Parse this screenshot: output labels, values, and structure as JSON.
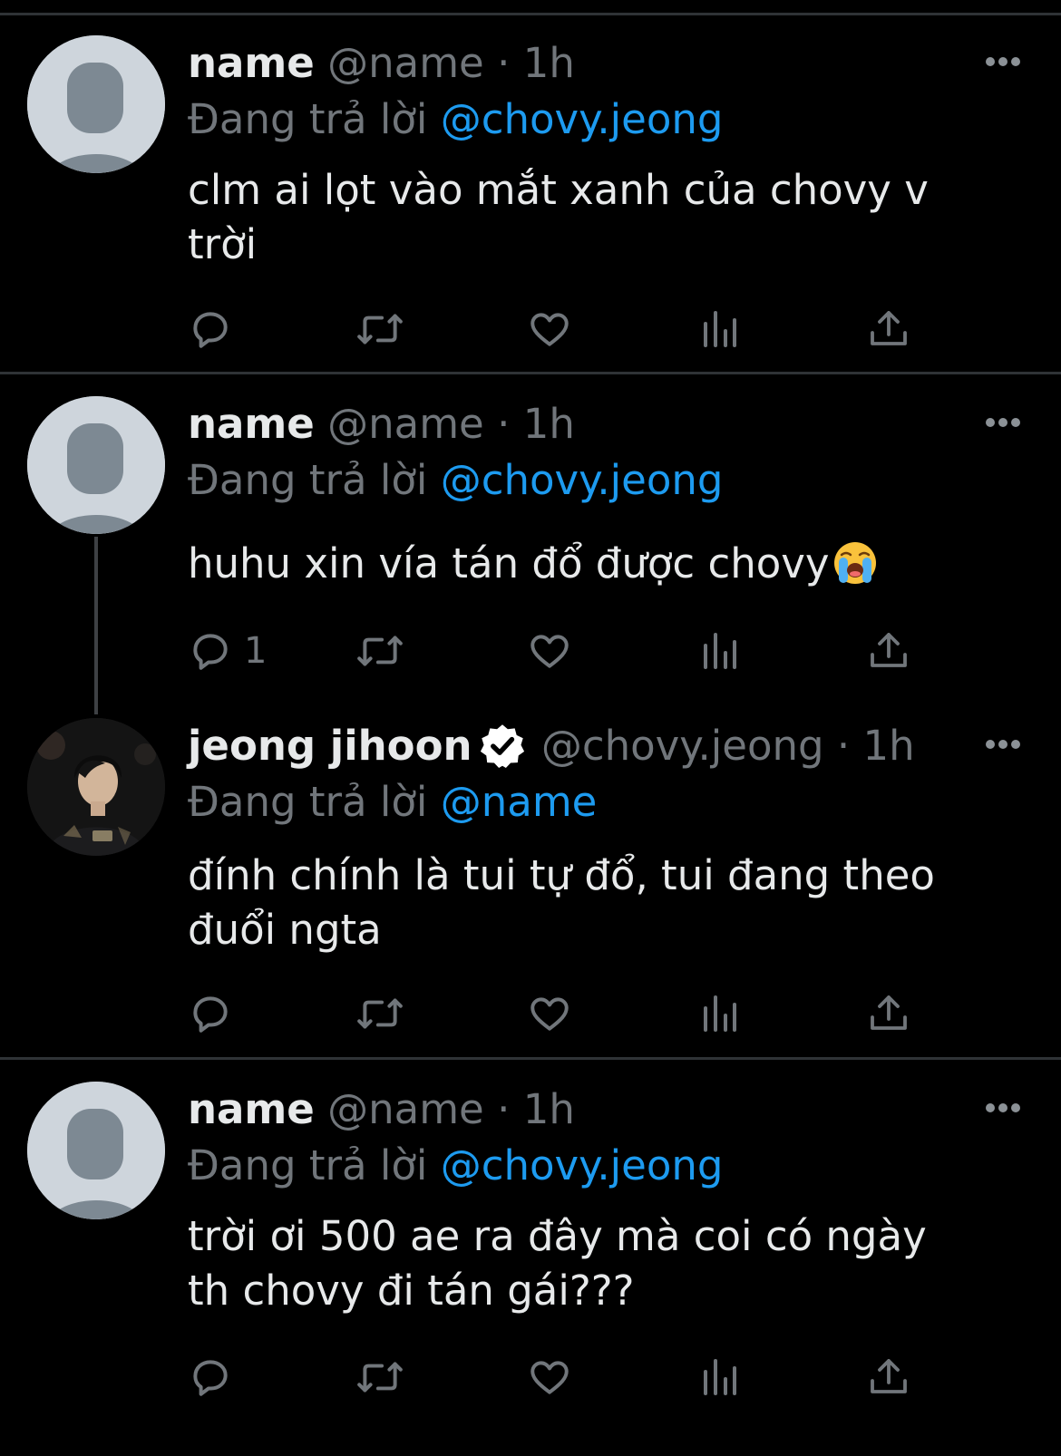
{
  "tweets": [
    {
      "display_name": "name",
      "handle": "@name",
      "separator": "·",
      "time": "1h",
      "replying_prefix": "Đang trả lời",
      "replying_to": "@chovy.jeong",
      "text_line1": "clm ai lọt vào mắt xanh của chovy v",
      "text_line2": "trời",
      "reply_count": "",
      "avatar": "default-avatar"
    },
    {
      "display_name": "name",
      "handle": "@name",
      "separator": "·",
      "time": "1h",
      "replying_prefix": "Đang trả lời",
      "replying_to": "@chovy.jeong",
      "text_line1": "huhu xin vía tán đổ được chovy",
      "emoji": "loudly-crying-face",
      "reply_count": "1",
      "avatar": "default-avatar"
    },
    {
      "display_name": "jeong jihoon",
      "verified": true,
      "handle": "@chovy.jeong",
      "separator": "·",
      "time": "1h",
      "replying_prefix": "Đang trả lời",
      "replying_to": "@name",
      "text_line1": "đính chính là tui tự đổ, tui đang theo",
      "text_line2": "đuổi ngta",
      "reply_count": "",
      "avatar": "profile-photo"
    },
    {
      "display_name": "name",
      "handle": "@name",
      "separator": "·",
      "time": "1h",
      "replying_prefix": "Đang trả lời",
      "replying_to": "@chovy.jeong",
      "text_line1": "trời ơi 500 ae ra đây mà coi có ngày",
      "text_line2": "th chovy đi tán gái???",
      "reply_count": "",
      "avatar": "default-avatar"
    }
  ],
  "icons": [
    "reply-icon",
    "retweet-icon",
    "like-icon",
    "views-icon",
    "share-icon",
    "more-icon",
    "verified-badge-icon"
  ],
  "colors": {
    "background": "#000000",
    "text": "#e7e9ea",
    "secondary": "#71767b",
    "mention": "#1d9bf0",
    "divider": "#2f3336"
  }
}
